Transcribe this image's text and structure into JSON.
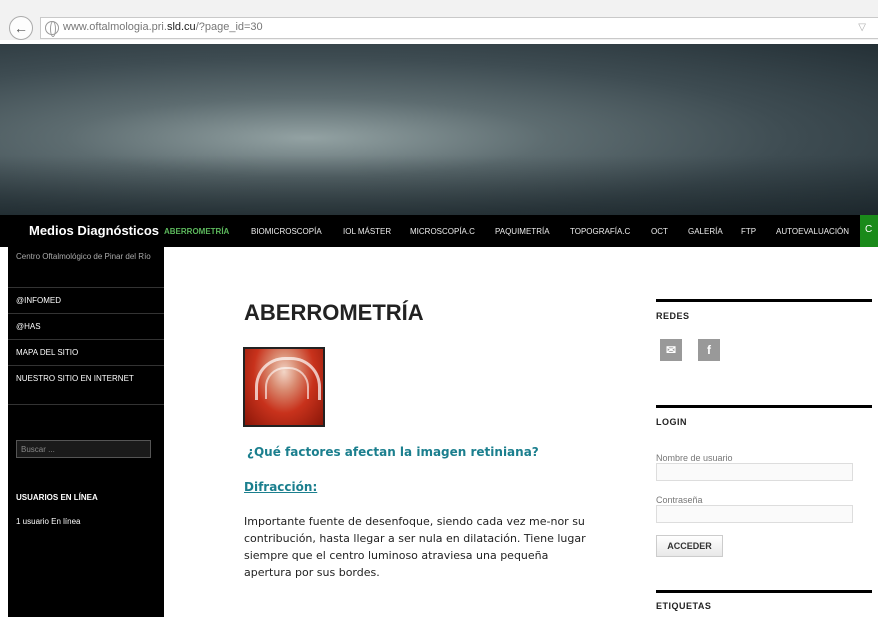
{
  "browser": {
    "url_prefix": "www.oftalmologia.pri.",
    "url_domain": "sld.cu",
    "url_suffix": "/?page_id=30",
    "back_icon": "back-arrow-icon"
  },
  "site": {
    "title": "Medios Diagnósticos",
    "tagline": "Centro Oftalmológico de Pinar del Río"
  },
  "nav": {
    "items": [
      {
        "label": "ABERROMETRÍA",
        "active": true
      },
      {
        "label": "BIOMICROSCOPÍA"
      },
      {
        "label": "IOL MÁSTER"
      },
      {
        "label": "MICROSCOPÍA.C"
      },
      {
        "label": "PAQUIMETRÍA"
      },
      {
        "label": "TOPOGRAFÍA.C"
      },
      {
        "label": "OCT"
      },
      {
        "label": "GALERÍA"
      },
      {
        "label": "FTP"
      },
      {
        "label": "AUTOEVALUACIÓN"
      }
    ],
    "overflow_label": "C"
  },
  "sidebar": {
    "links": [
      "@INFOMED",
      "@HAS",
      "MAPA DEL SITIO",
      "NUESTRO SITIO EN INTERNET"
    ],
    "search_placeholder": "Buscar ...",
    "online_heading": "USUARIOS EN LÍNEA",
    "online_text": "1 usuario En línea"
  },
  "main": {
    "title": "ABERROMETRÍA",
    "question": "¿Qué factores afectan la imagen retiniana?",
    "section_heading": "Difracción:",
    "paragraph": "Importante fuente de desenfoque, siendo cada vez me-nor su contribución, hasta llegar a ser nula en dilatación. Tiene lugar siempre que el centro luminoso atraviesa una pequeña apertura por sus bordes."
  },
  "widgets": {
    "redes_title": "REDES",
    "email_icon": "✉",
    "facebook_icon": "f",
    "login_title": "LOGIN",
    "username_label": "Nombre de usuario",
    "password_label": "Contraseña",
    "login_button": "ACCEDER",
    "tags_title": "ETIQUETAS"
  },
  "colors": {
    "accent_teal": "#1b7f8e",
    "nav_active": "#5cb85c",
    "nav_bg": "#000000"
  }
}
